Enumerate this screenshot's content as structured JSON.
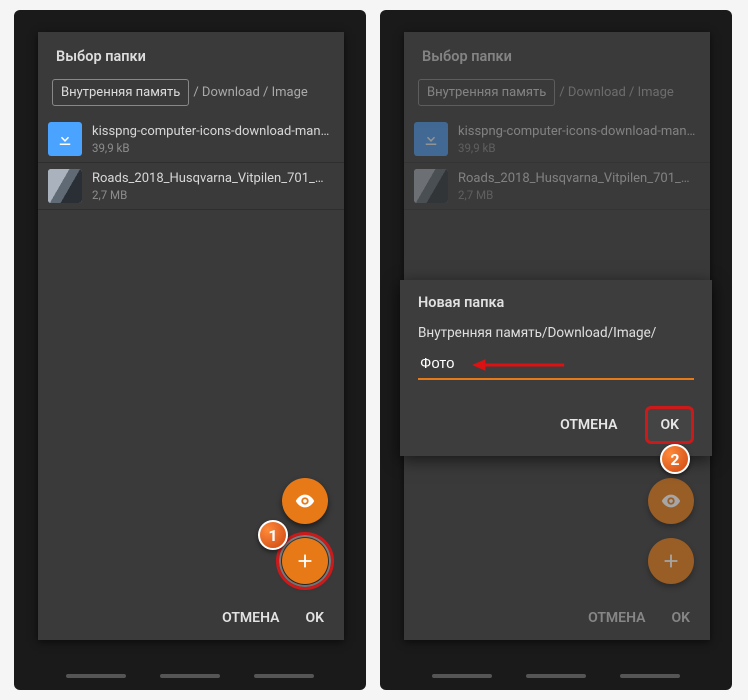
{
  "left": {
    "title": "Выбор папки",
    "breadcrumb": {
      "root": "Внутренняя память",
      "rest": "/ Download  / Image"
    },
    "files": [
      {
        "name": "kisspng-computer-icons-download-mana…",
        "size": "39,9 kB"
      },
      {
        "name": "Roads_2018_Husqvarna_Vitpilen_701_M…",
        "size": "2,7 MB"
      }
    ],
    "actions": {
      "cancel": "ОТМЕНА",
      "ok": "OK"
    },
    "step": "1"
  },
  "right": {
    "title": "Выбор папки",
    "breadcrumb": {
      "root": "Внутренняя память",
      "rest": "/ Download  / Image"
    },
    "files": [
      {
        "name": "kisspng-computer-icons-download-mana…",
        "size": "39,9 kB"
      },
      {
        "name": "Roads_2018_Husqvarna_Vitpilen_701_M…",
        "size": "2,7 MB"
      }
    ],
    "actions": {
      "cancel": "ОТМЕНА",
      "ok": "OK"
    },
    "new_folder": {
      "title": "Новая папка",
      "path": "Внутренняя память/Download/Image/",
      "value": "Фото",
      "cancel": "ОТМЕНА",
      "ok": "OK"
    },
    "step": "2"
  }
}
